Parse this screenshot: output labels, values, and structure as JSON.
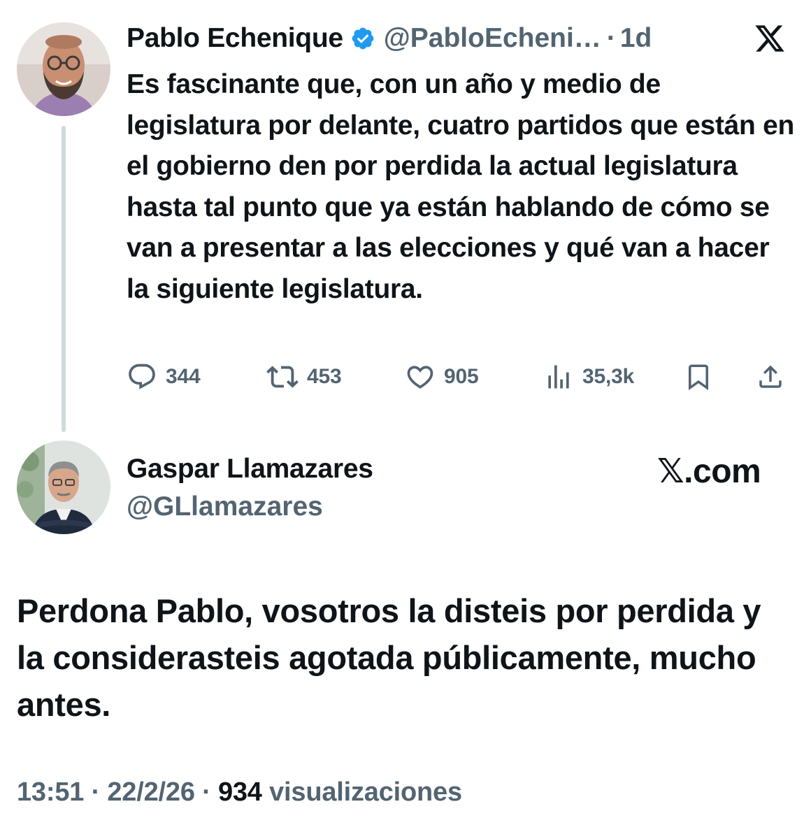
{
  "tweet": {
    "author_name": "Pablo Echenique",
    "author_handle": "@PabloEcheni…",
    "separator": "·",
    "time_ago": "1d",
    "text": "Es fascinante que, con un año y medio de legislatura por delante, cuatro partidos que están en el gobierno den por perdida la actual legislatura hasta tal punto que ya están hablando de cómo se van a presentar a las elecciones y qué van a hacer la siguiente legislatura.",
    "stats": {
      "replies": "344",
      "reposts": "453",
      "likes": "905",
      "views": "35,3k"
    }
  },
  "reply": {
    "author_name": "Gaspar Llamazares",
    "author_handle": "@GLlamazares",
    "brand": "𝕏.com",
    "text": "Perdona Pablo, vosotros la disteis por perdida y la considerasteis agotada públicamente, mucho antes.",
    "time": "13:51",
    "date": "22/2/26",
    "views_count": "934",
    "views_label": "visualizaciones"
  },
  "icons": {
    "verified": "verified-badge-icon",
    "x_logo": "x-logo-icon",
    "reply": "reply-icon",
    "repost": "repost-icon",
    "like": "heart-icon",
    "views": "views-icon",
    "bookmark": "bookmark-icon",
    "share": "share-icon"
  },
  "colors": {
    "text": "#0f1419",
    "secondary": "#536471",
    "verified": "#1d9bf0",
    "thread_line": "#cfd9de"
  }
}
